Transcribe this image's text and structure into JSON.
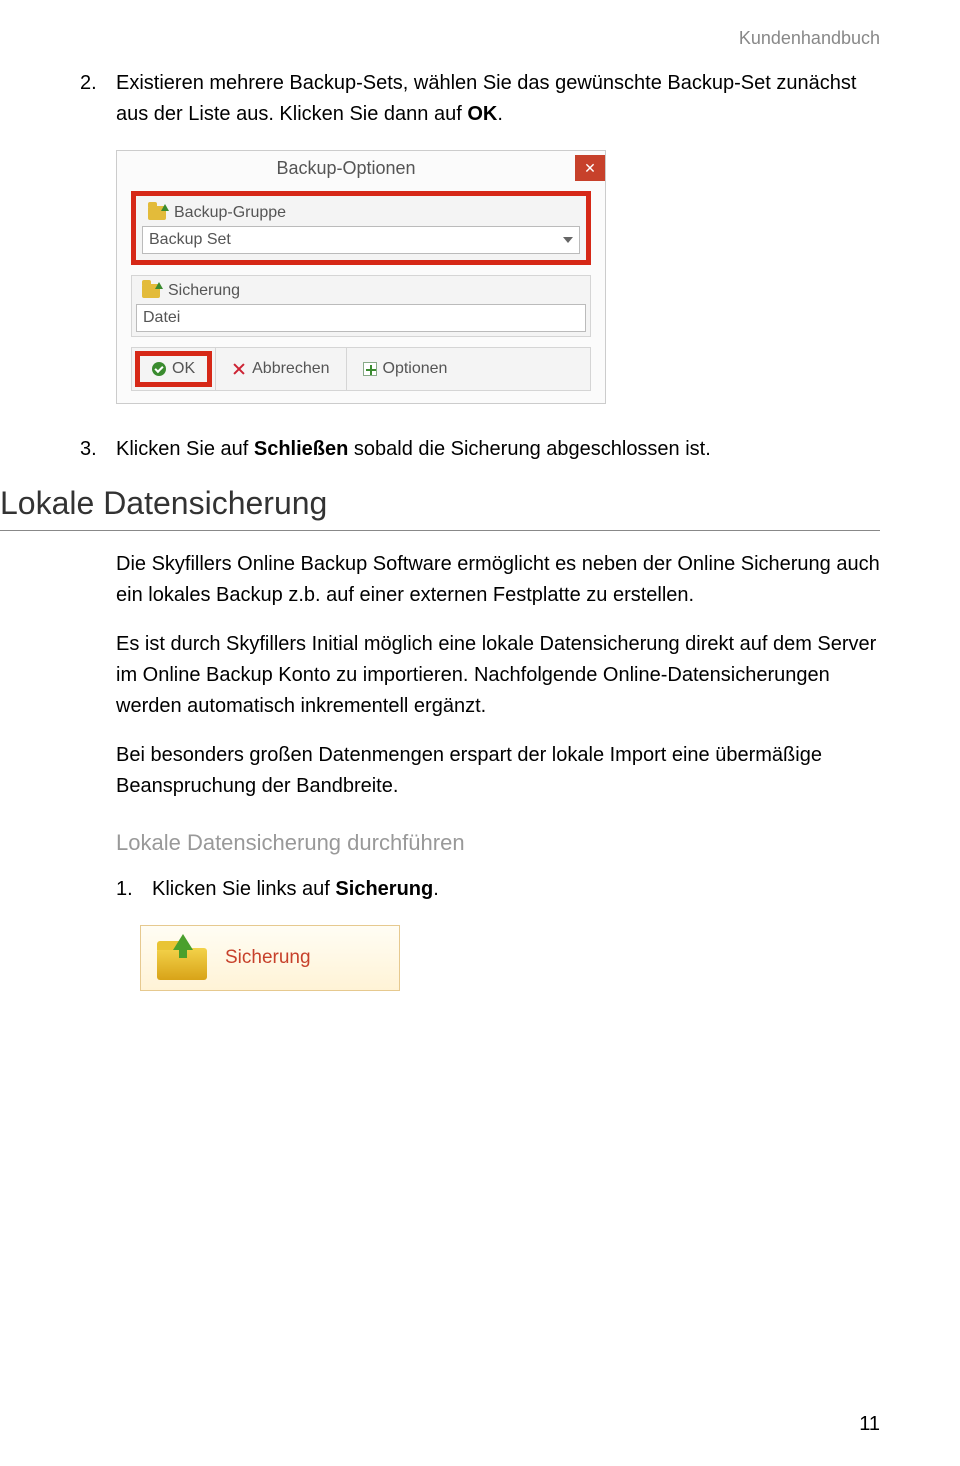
{
  "header": {
    "doc_title": "Kundenhandbuch"
  },
  "steps": {
    "s2": {
      "num": "2.",
      "pre": "Existieren mehrere Backup-Sets, wählen Sie das gewünschte Backup-Set zunächst aus der Liste aus. Klicken Sie dann auf ",
      "bold": "OK",
      "post": "."
    },
    "s3": {
      "num": "3.",
      "pre": "Klicken Sie auf ",
      "bold": "Schließen",
      "post": " sobald die Sicherung abgeschlossen ist."
    }
  },
  "dialog": {
    "title": "Backup-Optionen",
    "group1_label": "Backup-Gruppe",
    "group1_value": "Backup Set",
    "group2_label": "Sicherung",
    "group2_value": "Datei",
    "btn_ok": "OK",
    "btn_cancel": "Abbrechen",
    "btn_options": "Optionen"
  },
  "section": {
    "h2": "Lokale Datensicherung",
    "p1": "Die Skyfillers Online Backup Software ermöglicht es neben der Online Sicherung auch ein lokales Backup z.b. auf einer externen Festplatte zu erstellen.",
    "p2": "Es ist durch Skyfillers Initial möglich eine lokale Datensicherung direkt auf dem Server im Online Backup Konto zu importieren. Nachfolgende Online-Datensicherungen werden automatisch inkrementell ergänzt.",
    "p3": "Bei besonders großen Datenmengen erspart der lokale Import eine übermäßige Beanspruchung der Bandbreite.",
    "h3": "Lokale Datensicherung durchführen",
    "step1": {
      "num": "1.",
      "pre": "Klicken Sie links auf ",
      "bold": "Sicherung",
      "post": "."
    }
  },
  "sicherung_btn": {
    "label": "Sicherung"
  },
  "page_number": "11"
}
